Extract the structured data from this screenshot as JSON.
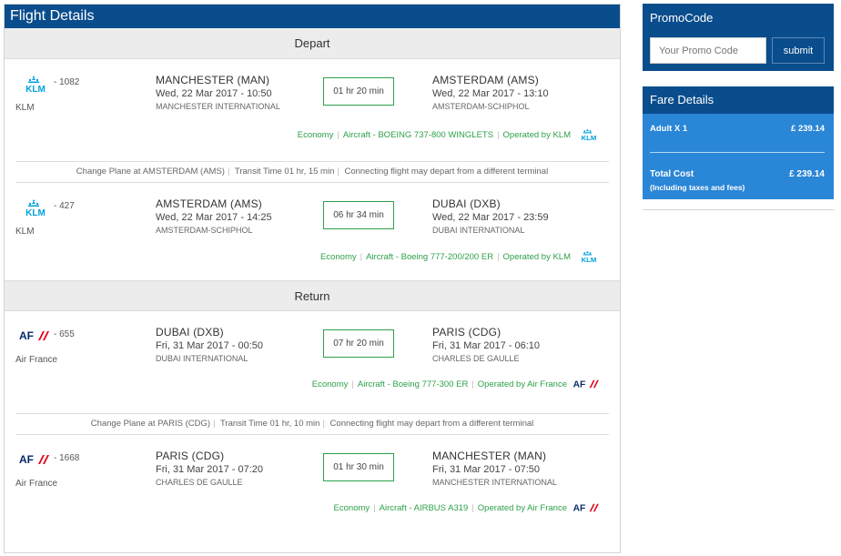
{
  "header": {
    "title": "Flight Details"
  },
  "sections": {
    "depart": "Depart",
    "return": "Return"
  },
  "flights": [
    {
      "airline": "KLM",
      "logo": "klm-logo-icon",
      "number": "- 1082",
      "from_city": "MANCHESTER (MAN)",
      "from_dt": "Wed, 22 Mar 2017 - 10:50",
      "from_airport": "MANCHESTER INTERNATIONAL",
      "duration": "01 hr 20 min",
      "to_city": "AMSTERDAM (AMS)",
      "to_dt": "Wed, 22 Mar 2017 - 13:10",
      "to_airport": "AMSTERDAM-SCHIPHOL",
      "cabin": "Economy",
      "aircraft": "Aircraft - BOEING 737-800 WINGLETS",
      "operated": "Operated by KLM"
    },
    {
      "airline": "KLM",
      "logo": "klm-logo-icon",
      "number": "- 427",
      "from_city": "AMSTERDAM (AMS)",
      "from_dt": "Wed, 22 Mar 2017 - 14:25",
      "from_airport": "AMSTERDAM-SCHIPHOL",
      "duration": "06 hr 34 min",
      "to_city": "DUBAI (DXB)",
      "to_dt": "Wed, 22 Mar 2017 - 23:59",
      "to_airport": "DUBAI INTERNATIONAL",
      "cabin": "Economy",
      "aircraft": "Aircraft - Boeing 777-200/200 ER",
      "operated": "Operated by KLM"
    },
    {
      "airline": "Air France",
      "logo": "air-france-logo-icon",
      "number": "- 655",
      "from_city": "DUBAI (DXB)",
      "from_dt": "Fri, 31 Mar 2017 - 00:50",
      "from_airport": "DUBAI INTERNATIONAL",
      "duration": "07 hr 20 min",
      "to_city": "PARIS (CDG)",
      "to_dt": "Fri, 31 Mar 2017 - 06:10",
      "to_airport": "CHARLES DE GAULLE",
      "cabin": "Economy",
      "aircraft": "Aircraft - Boeing 777-300 ER",
      "operated": "Operated by Air France"
    },
    {
      "airline": "Air France",
      "logo": "air-france-logo-icon",
      "number": "- 1668",
      "from_city": "PARIS (CDG)",
      "from_dt": "Fri, 31 Mar 2017 - 07:20",
      "from_airport": "CHARLES DE GAULLE",
      "duration": "01 hr 30 min",
      "to_city": "MANCHESTER (MAN)",
      "to_dt": "Fri, 31 Mar 2017 - 07:50",
      "to_airport": "MANCHESTER INTERNATIONAL",
      "cabin": "Economy",
      "aircraft": "Aircraft - AIRBUS A319",
      "operated": "Operated by Air France"
    }
  ],
  "changes": [
    {
      "plane": "Change Plane at AMSTERDAM (AMS)",
      "transit": "Transit Time 01 hr, 15 min",
      "note": "Connecting flight may depart from a different terminal"
    },
    {
      "plane": "Change Plane at PARIS (CDG)",
      "transit": "Transit Time 01 hr, 10 min",
      "note": "Connecting flight may depart from a different terminal"
    }
  ],
  "promo": {
    "title": "PromoCode",
    "placeholder": "Your Promo Code",
    "submit": "submit"
  },
  "fare": {
    "title": "Fare Details",
    "adult_label": "Adult X 1",
    "adult_value": "£ 239.14",
    "total_label": "Total Cost",
    "total_value": "£ 239.14",
    "total_note": "(Including taxes and fees)"
  },
  "colors": {
    "brand": "#0a4d8c",
    "accent": "#2a86d6",
    "green": "#2ea04a",
    "klm": "#00a1de",
    "af_red": "#e2001a"
  }
}
